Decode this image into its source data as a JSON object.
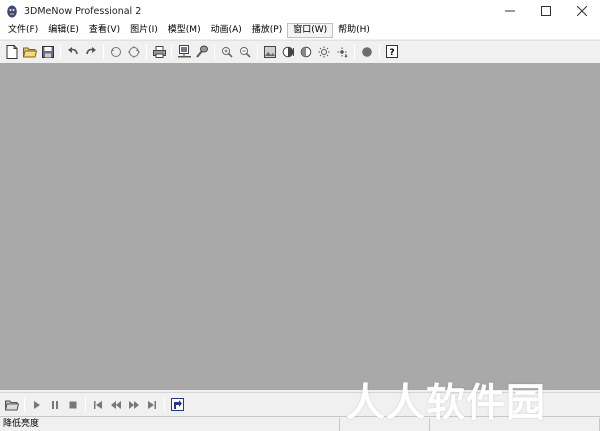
{
  "window": {
    "title": "3DMeNow Professional 2",
    "controls": [
      "minimize",
      "maximize",
      "close"
    ]
  },
  "menubar": {
    "items": [
      {
        "label": "文件(F)"
      },
      {
        "label": "编辑(E)"
      },
      {
        "label": "查看(V)"
      },
      {
        "label": "图片(I)"
      },
      {
        "label": "模型(M)"
      },
      {
        "label": "动画(A)"
      },
      {
        "label": "播放(P)"
      },
      {
        "label": "窗口(W)",
        "active": true
      },
      {
        "label": "帮助(H)"
      }
    ]
  },
  "toolbar": {
    "icons": [
      "new-file-icon",
      "open-folder-icon",
      "save-icon",
      "undo-icon",
      "redo-icon",
      "rotate-left-icon",
      "rotate-right-icon",
      "print-icon",
      "import-photo-icon",
      "edit-model-icon",
      "zoom-in-icon",
      "zoom-out-icon",
      "image-icon",
      "contrast-icon",
      "half-circle-icon",
      "brightness-up-icon",
      "brightness-down-icon",
      "record-circle-icon",
      "help-icon"
    ]
  },
  "playerbar": {
    "icons": [
      "open-icon",
      "play-icon",
      "pause-icon",
      "stop-icon",
      "first-frame-icon",
      "rewind-icon",
      "fast-forward-icon",
      "last-frame-icon",
      "export-icon"
    ]
  },
  "statusbar": {
    "text": "降低亮度"
  },
  "watermark": {
    "text": "人人软件园"
  },
  "colors": {
    "workspace": "#a9a9a9",
    "chrome": "#f0f0f0",
    "titlebar": "#ffffff"
  }
}
